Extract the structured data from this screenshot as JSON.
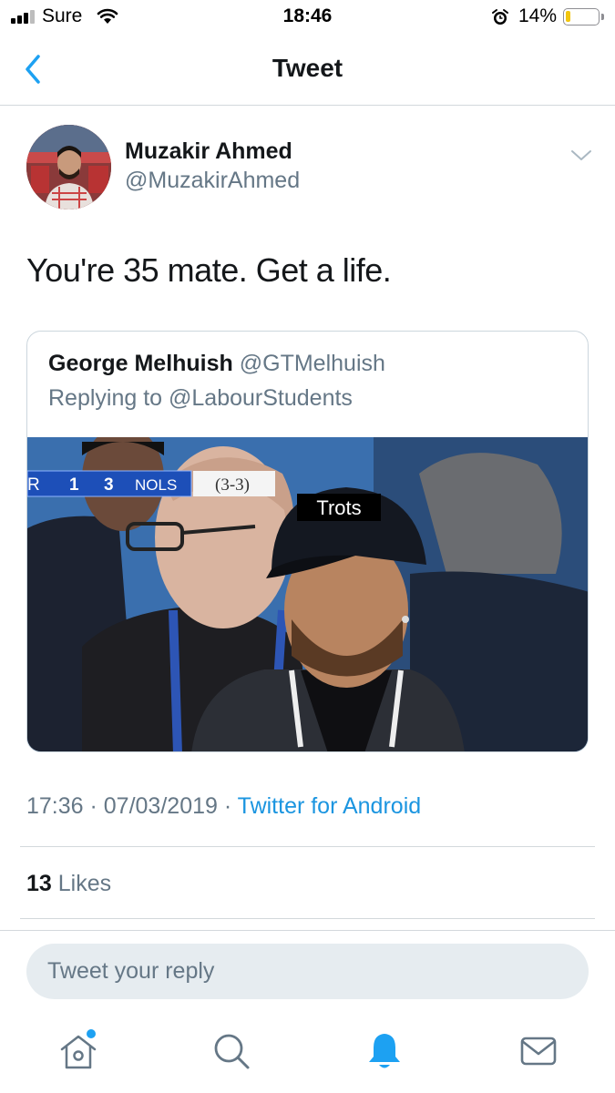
{
  "status_bar": {
    "carrier": "Sure",
    "time": "18:46",
    "battery_percent": "14%",
    "signal_strength": 3
  },
  "nav": {
    "title": "Tweet",
    "back_icon": "chevron-left-icon"
  },
  "tweet": {
    "display_name": "Muzakir Ahmed",
    "handle": "@MuzakirAhmed",
    "text": "You're 35 mate. Get a life.",
    "timestamp": "17:36 · 07/03/2019 · ",
    "source": "Twitter for Android",
    "likes_count": "13",
    "likes_label": " Likes"
  },
  "quoted_tweet": {
    "display_name": "George Melhuish",
    "handle": "@GTMelhuish",
    "replying_to": "Replying to @LabourStudents",
    "image": {
      "scoreboard_left": "R",
      "score_home": "1",
      "score_away": "3",
      "team": "NOLS",
      "aggregate": "(3-3)",
      "caption": "Trots"
    }
  },
  "reply": {
    "placeholder": "Tweet your reply"
  },
  "tab_bar": {
    "items": [
      "home-icon",
      "search-icon",
      "notifications-icon",
      "messages-icon"
    ],
    "active": "notifications-icon"
  },
  "colors": {
    "accent": "#1da1f2",
    "link": "#1b95e0",
    "secondary_text": "#657786",
    "primary_text": "#14171a"
  }
}
